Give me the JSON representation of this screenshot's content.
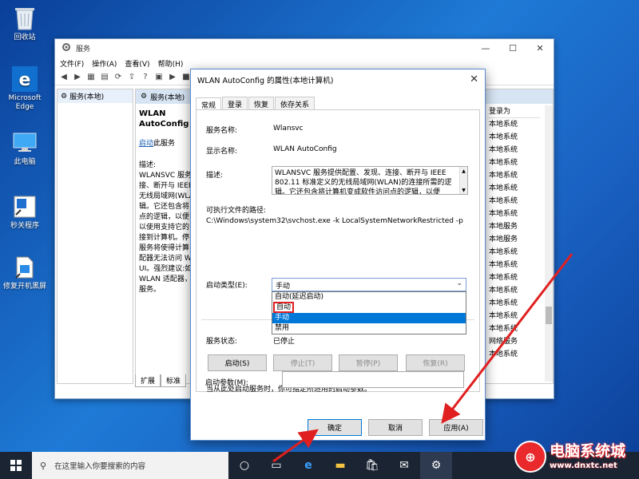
{
  "desktop": {
    "icons": [
      {
        "label": "回收站"
      },
      {
        "label": "Microsoft Edge"
      },
      {
        "label": "此电脑"
      },
      {
        "label": "秒关程序"
      },
      {
        "label": "修复开机黑屏"
      }
    ]
  },
  "services_window": {
    "title": "服务",
    "menu": [
      "文件(F)",
      "操作(A)",
      "查看(V)",
      "帮助(H)"
    ],
    "tree_item": "服务(本地)",
    "main_header": "服务(本地)",
    "service_name": "WLAN AutoConfig",
    "start_link": "启动",
    "start_suffix": "此服务",
    "desc_label": "描述:",
    "desc_lines": [
      "WLANSVC 服务",
      "接、断开与 IEEE",
      "无线局域网(WLA",
      "辑。它还包含将",
      "点的逻辑，以便",
      "以使用支持它的",
      "接到计算机。停",
      "服务将使得计算",
      "配器无法访问 W",
      "UI。强烈建议:如",
      "WLAN 适配器，",
      "服务。"
    ],
    "column_header": "登录为",
    "logon_values": [
      "本地系统",
      "本地系统",
      "本地系统",
      "本地系统",
      "本地系统",
      "本地系统",
      "本地系统",
      "本地系统",
      "本地服务",
      "本地服务",
      "本地系统",
      "本地系统",
      "本地系统",
      "本地系统",
      "本地系统",
      "本地系统",
      "本地系统",
      "网络服务",
      "本地系统"
    ],
    "bottom_tabs": [
      "扩展",
      "标准"
    ]
  },
  "dialog": {
    "title": "WLAN AutoConfig 的属性(本地计算机)",
    "tabs": [
      "常规",
      "登录",
      "恢复",
      "依存关系"
    ],
    "service_name_label": "服务名称:",
    "service_name_value": "Wlansvc",
    "display_name_label": "显示名称:",
    "display_name_value": "WLAN AutoConfig",
    "description_label": "描述:",
    "description_value": "WLANSVC 服务提供配置、发现、连接、断开与 IEEE 802.11 标准定义的无线局域网(WLAN)的连接所需的逻辑。它还包含将计算机变成软件访问点的逻辑，以便",
    "exe_path_label": "可执行文件的路径:",
    "exe_path_value": "C:\\Windows\\system32\\svchost.exe -k LocalSystemNetworkRestricted -p",
    "startup_type_label": "启动类型(E):",
    "startup_type_value": "手动",
    "startup_options": [
      "自动(延迟启动)",
      "自动",
      "手动",
      "禁用"
    ],
    "status_label": "服务状态:",
    "status_value": "已停止",
    "buttons": {
      "start": "启动(S)",
      "stop": "停止(T)",
      "pause": "暂停(P)",
      "resume": "恢复(R)"
    },
    "hint": "当从此处启动服务时，你可指定所适用的启动参数。",
    "params_label": "启动参数(M):",
    "params_value": "",
    "footer": {
      "ok": "确定",
      "cancel": "取消",
      "apply": "应用(A)"
    }
  },
  "taskbar": {
    "search_placeholder": "在这里输入你要搜索的内容"
  },
  "watermark": {
    "text": "电脑系统城",
    "url": "www.dnxtc.net"
  },
  "colors": {
    "accent": "#0078d7",
    "highlight_box": "#e02020",
    "arrow": "#e02020"
  }
}
